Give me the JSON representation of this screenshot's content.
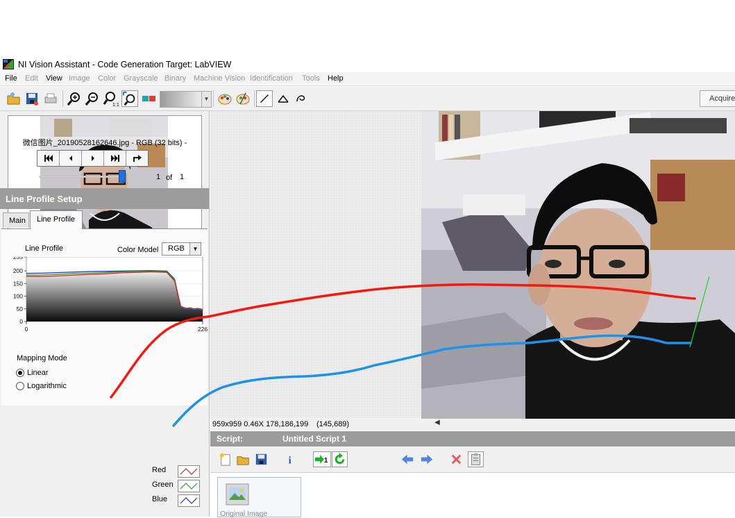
{
  "window": {
    "title": "NI Vision Assistant - Code Generation Target: LabVIEW"
  },
  "menu": [
    {
      "label": "File",
      "enabled": true
    },
    {
      "label": "Edit",
      "enabled": false
    },
    {
      "label": "View",
      "enabled": true
    },
    {
      "label": "Image",
      "enabled": false
    },
    {
      "label": "Color",
      "enabled": false
    },
    {
      "label": "Grayscale",
      "enabled": false
    },
    {
      "label": "Binary",
      "enabled": false
    },
    {
      "label": "Machine Vision",
      "enabled": false
    },
    {
      "label": "Identification",
      "enabled": false
    },
    {
      "label": "Tools",
      "enabled": false
    },
    {
      "label": "Help",
      "enabled": true
    }
  ],
  "toolbar": {
    "icons": [
      "open-image-icon",
      "save-image-icon",
      "print-icon",
      "zoom-in-icon",
      "zoom-out-icon",
      "zoom-1-to-1-icon",
      "zoom-to-fit-icon",
      "palette-icon",
      "color-palette-icon",
      "color-palette-2-icon",
      "line-tool-icon",
      "broken-line-tool-icon",
      "freehand-line-tool-icon"
    ],
    "acquire_label": "Acquire"
  },
  "browser": {
    "filename": "微信图片_20190528162646.jpg - RGB (32 bits) -",
    "page_current": "1",
    "page_of": "of",
    "page_total": "1",
    "slider_value": 1.0
  },
  "setup": {
    "title": "Line Profile Setup",
    "tabs": [
      {
        "label": "Main",
        "active": false
      },
      {
        "label": "Line Profile",
        "active": true
      }
    ],
    "line_profile_label": "Line Profile",
    "color_model_label": "Color Model",
    "color_model_value": "RGB",
    "mapping_mode_label": "Mapping Mode",
    "mapping_options": [
      {
        "label": "Linear",
        "selected": true
      },
      {
        "label": "Logarithmic",
        "selected": false
      }
    ],
    "channels": [
      {
        "label": "Red",
        "color": "#d42020"
      },
      {
        "label": "Green",
        "color": "#20a020"
      },
      {
        "label": "Blue",
        "color": "#2030c8"
      }
    ]
  },
  "chart_data": {
    "type": "line",
    "title": "Line Profile",
    "xlabel": "",
    "ylabel": "",
    "xlim": [
      0,
      226
    ],
    "ylim": [
      0,
      255
    ],
    "y_ticks": [
      0,
      50,
      100,
      150,
      200,
      255
    ],
    "x_tick_labels": [
      "0",
      "226"
    ],
    "series": [
      {
        "name": "Red",
        "color": "#d42020",
        "x": [
          0,
          20,
          40,
          60,
          80,
          100,
          120,
          140,
          160,
          180,
          190,
          198,
          205,
          210,
          215,
          220,
          226
        ],
        "y": [
          178,
          178,
          180,
          183,
          186,
          188,
          192,
          194,
          196,
          194,
          160,
          60,
          52,
          54,
          50,
          52,
          48
        ]
      },
      {
        "name": "Green",
        "color": "#20a020",
        "x": [
          0,
          20,
          40,
          60,
          80,
          100,
          120,
          140,
          160,
          180,
          190,
          198,
          205,
          210,
          215,
          220,
          226
        ],
        "y": [
          183,
          184,
          186,
          189,
          191,
          193,
          196,
          198,
          199,
          197,
          165,
          58,
          50,
          52,
          48,
          50,
          46
        ]
      },
      {
        "name": "Blue",
        "color": "#2030c8",
        "x": [
          0,
          20,
          40,
          60,
          80,
          100,
          120,
          140,
          160,
          180,
          190,
          198,
          205,
          210,
          215,
          220,
          226
        ],
        "y": [
          190,
          191,
          193,
          195,
          197,
          198,
          199,
          200,
          201,
          199,
          168,
          55,
          45,
          48,
          44,
          46,
          42
        ]
      }
    ]
  },
  "viewer": {
    "status_info": "959x959 0.46X 178,186,199",
    "status_coords": "(145,689)"
  },
  "script": {
    "label": "Script:",
    "name": "Untitled Script 1",
    "toolbar_icons": [
      "new-script-icon",
      "open-script-icon",
      "save-script-icon",
      "info-icon",
      "run-once-icon",
      "run-continuous-icon",
      "step-back-icon",
      "step-forward-icon",
      "delete-step-icon",
      "clipboard-icon"
    ],
    "steps": [
      {
        "label": "Original Image"
      }
    ]
  }
}
